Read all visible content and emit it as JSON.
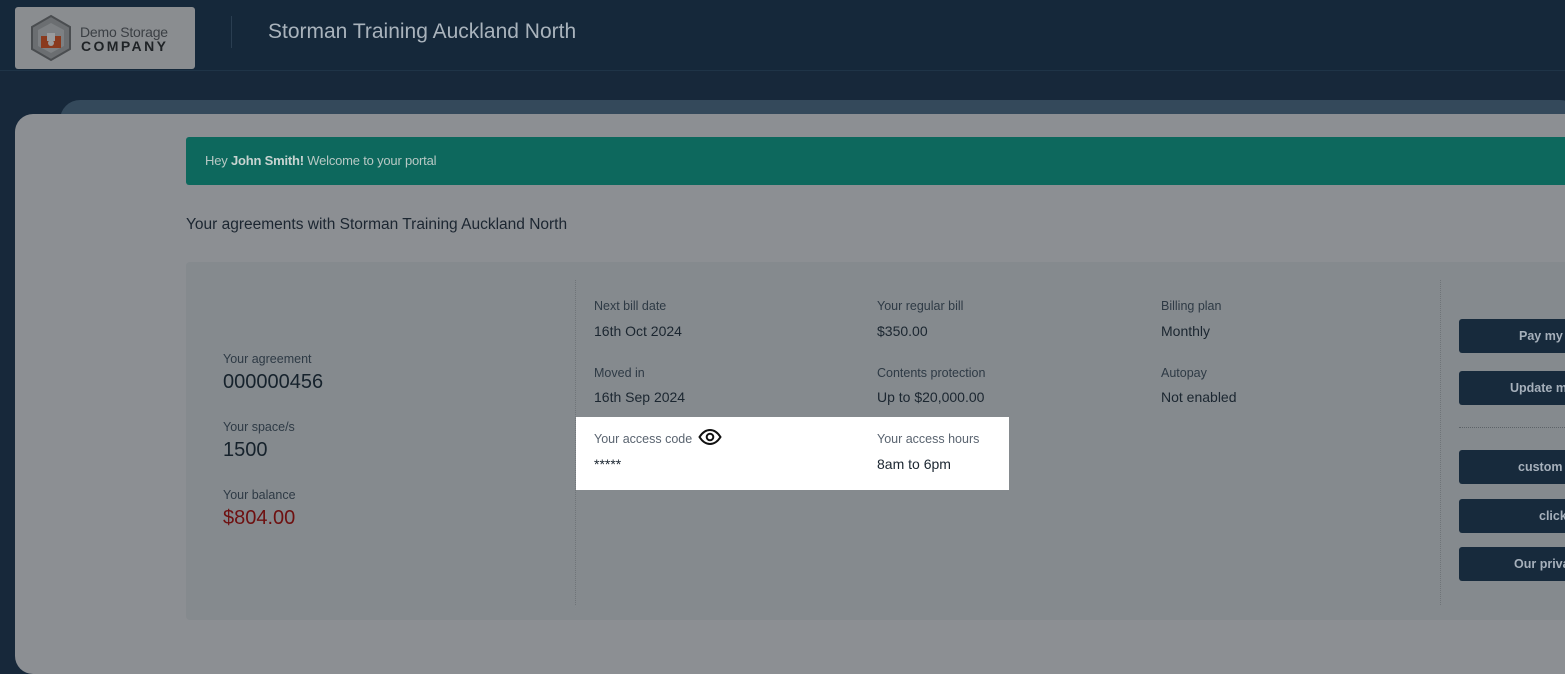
{
  "header": {
    "logo": {
      "line1": "Demo Storage",
      "line2": "COMPANY"
    },
    "site_title": "Storman Training Auckland North"
  },
  "welcome": {
    "prefix": "Hey",
    "name": "John Smith!",
    "suffix": "Welcome to your portal"
  },
  "agreements": {
    "title": "Your agreements with Storman Training Auckland North",
    "agreement_label": "Your agreement",
    "agreement_value": "000000456",
    "space_label": "Your space/s",
    "space_value": "1500",
    "balance_label": "Your balance",
    "balance_value": "$804.00",
    "next_bill_label": "Next bill date",
    "next_bill_value": "16th Oct 2024",
    "regular_bill_label": "Your regular bill",
    "regular_bill_value": "$350.00",
    "billing_plan_label": "Billing plan",
    "billing_plan_value": "Monthly",
    "moved_in_label": "Moved in",
    "moved_in_value": "16th Sep 2024",
    "contents_label": "Contents protection",
    "contents_value": "Up to $20,000.00",
    "autopay_label": "Autopay",
    "autopay_value": "Not enabled",
    "access_code_label": "Your access code",
    "access_code_value": "*****",
    "access_hours_label": "Your access hours",
    "access_hours_value": "8am to 6pm"
  },
  "actions": {
    "pay": "Pay my",
    "update": "Update m",
    "custom": "custom",
    "click": "click",
    "privacy": "Our priva"
  },
  "icons": [
    "logo-icon",
    "eye-icon"
  ],
  "colors": {
    "topbar": "#15283a",
    "welcome_bar": "#0d685d",
    "balance": "#6e1010",
    "button": "#172a3c"
  }
}
